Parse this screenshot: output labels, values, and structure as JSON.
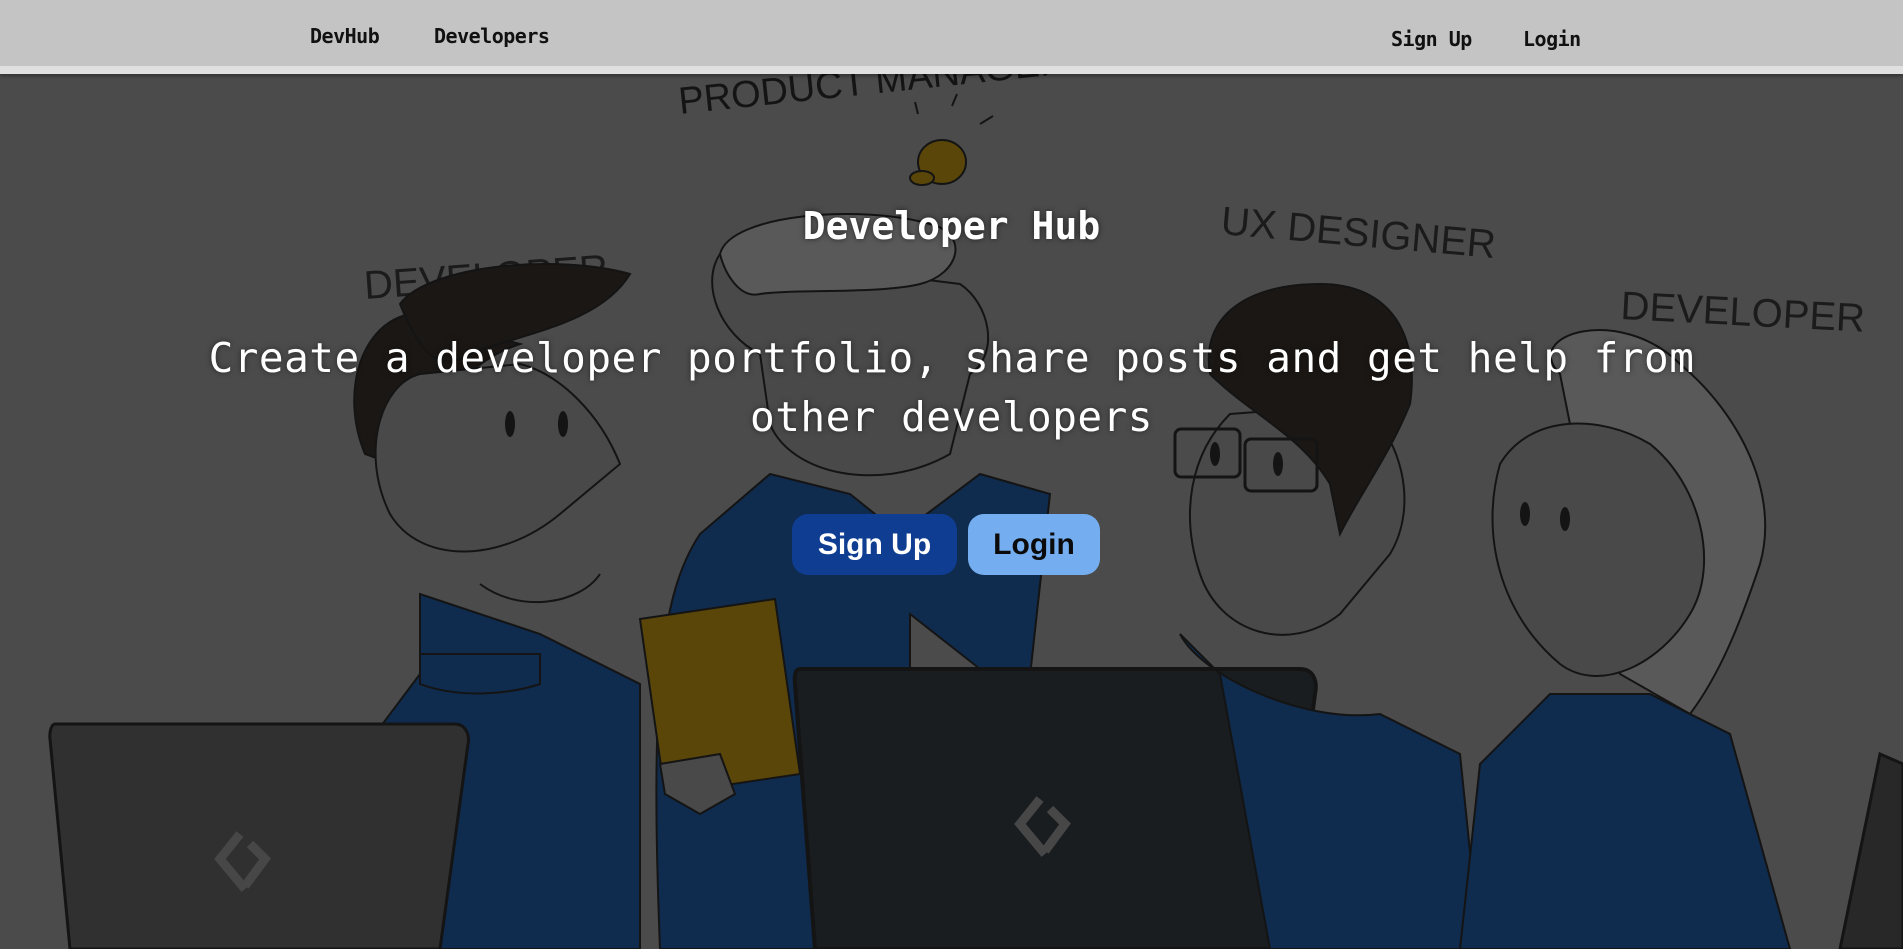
{
  "navbar": {
    "brand": "DevHub",
    "developers_link": "Developers",
    "signup_link": "Sign Up",
    "login_link": "Login"
  },
  "hero": {
    "title": "Developer Hub",
    "lead": "Create a developer portfolio, share posts and get help from other developers",
    "signup_button": "Sign Up",
    "login_button": "Login",
    "illustration_labels": {
      "product_manager": "PRODUCT MANAGER",
      "developer_left": "DEVELOPER",
      "ux_designer": "UX DESIGNER",
      "developer_right": "DEVELOPER"
    }
  },
  "colors": {
    "navbar_bg": "#c4c4c4",
    "hero_bg": "#4d4d4d",
    "primary_button": "#0f3d91",
    "light_button": "#74aef0",
    "shirt_blue": "#0a2f5c",
    "bulb_yellow": "#6e5300"
  }
}
